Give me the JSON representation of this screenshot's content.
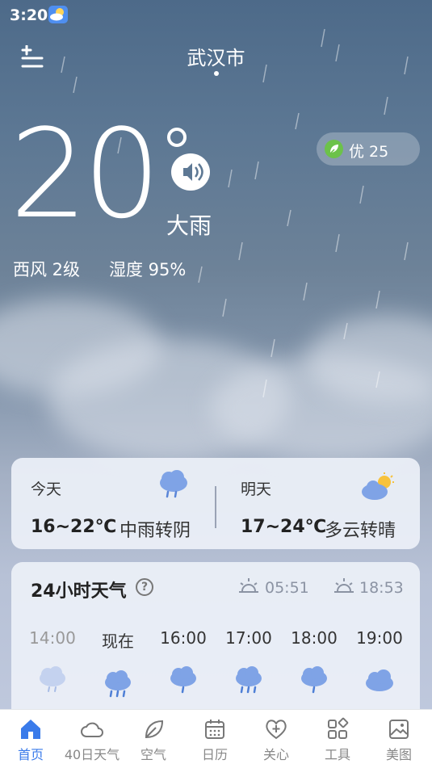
{
  "status_bar": {
    "time": "3:20"
  },
  "header": {
    "city": "武汉市"
  },
  "current": {
    "temperature": "20",
    "condition": "大雨",
    "wind": "西风 2级",
    "humidity": "湿度 95%"
  },
  "aqi": {
    "label": "优 25",
    "accent": "#6cc24a"
  },
  "forecast": [
    {
      "day": "今天",
      "range": "16~22℃",
      "desc": "中雨转阴",
      "icon": "rain-cloud-icon"
    },
    {
      "day": "明天",
      "range": "17~24℃",
      "desc": "多云转晴",
      "icon": "partly-cloudy-icon"
    }
  ],
  "hourly": {
    "title": "24小时天气",
    "sunrise": "05:51",
    "sunset": "18:53",
    "hours": [
      {
        "label": "14:00",
        "icon": "light-rain-icon",
        "past": true
      },
      {
        "label": "现在",
        "icon": "rain-icon",
        "past": false
      },
      {
        "label": "16:00",
        "icon": "rain-icon",
        "past": false
      },
      {
        "label": "17:00",
        "icon": "rain-icon",
        "past": false
      },
      {
        "label": "18:00",
        "icon": "rain-icon",
        "past": false
      },
      {
        "label": "19:00",
        "icon": "cloud-icon",
        "past": false
      }
    ]
  },
  "nav": {
    "active_color": "#3a7bea",
    "items": [
      {
        "label": "首页",
        "icon": "home-icon",
        "active": true
      },
      {
        "label": "40日天气",
        "icon": "cloud-icon",
        "active": false
      },
      {
        "label": "空气",
        "icon": "leaf-icon",
        "active": false
      },
      {
        "label": "日历",
        "icon": "calendar-icon",
        "active": false
      },
      {
        "label": "关心",
        "icon": "heart-plus-icon",
        "active": false
      },
      {
        "label": "工具",
        "icon": "tools-grid-icon",
        "active": false
      },
      {
        "label": "美图",
        "icon": "image-icon",
        "active": false
      }
    ]
  }
}
